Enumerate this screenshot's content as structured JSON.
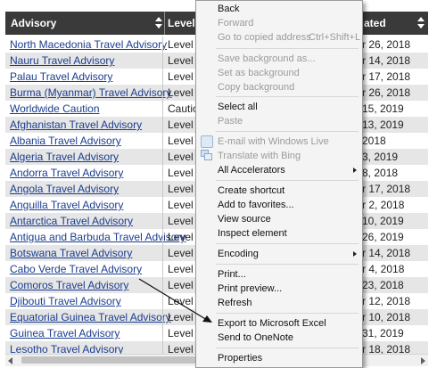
{
  "table": {
    "headers": {
      "advisory": "Advisory",
      "level": "Level",
      "updated": "ated"
    },
    "rows": [
      {
        "advisory": "North Macedonia Travel Advisory",
        "level": "Level 1",
        "updated": "r 26, 2018"
      },
      {
        "advisory": "Nauru Travel Advisory",
        "level": "Level 1",
        "updated": "r 14, 2018"
      },
      {
        "advisory": "Palau Travel Advisory",
        "level": "Level 1",
        "updated": "r 17, 2018"
      },
      {
        "advisory": "Burma (Myanmar) Travel Advisory",
        "level": "Level 2",
        "updated": "r 26, 2018"
      },
      {
        "advisory": "Worldwide Caution",
        "level": "Caution",
        "updated": "15, 2019"
      },
      {
        "advisory": "Afghanistan Travel Advisory",
        "level": "Level 4",
        "updated": "13, 2019"
      },
      {
        "advisory": "Albania Travel Advisory",
        "level": "Level 1",
        "updated": "2018"
      },
      {
        "advisory": "Algeria Travel Advisory",
        "level": "Level 2",
        "updated": "3, 2019"
      },
      {
        "advisory": "Andorra Travel Advisory",
        "level": "Level 1",
        "updated": "8, 2018"
      },
      {
        "advisory": "Angola Travel Advisory",
        "level": "Level 1",
        "updated": "r 17, 2018"
      },
      {
        "advisory": "Anguilla Travel Advisory",
        "level": "Level 1",
        "updated": "r 2, 2018"
      },
      {
        "advisory": "Antarctica Travel Advisory",
        "level": "Level 2",
        "updated": "10, 2019"
      },
      {
        "advisory": "Antigua and Barbuda Travel Advisory",
        "level": "Level 1",
        "updated": "26, 2019"
      },
      {
        "advisory": "Botswana Travel Advisory",
        "level": "Level 1",
        "updated": "r 14, 2018"
      },
      {
        "advisory": "Cabo Verde Travel Advisory",
        "level": "Level 1",
        "updated": "r 4, 2018"
      },
      {
        "advisory": "Comoros Travel Advisory",
        "level": "Level 2",
        "updated": "23, 2018"
      },
      {
        "advisory": "Djibouti Travel Advisory",
        "level": "Level 1",
        "updated": "r 12, 2018"
      },
      {
        "advisory": "Equatorial Guinea Travel Advisory",
        "level": "Level 1",
        "updated": "r 10, 2018"
      },
      {
        "advisory": "Guinea Travel Advisory",
        "level": "Level 1",
        "updated": "31, 2019"
      },
      {
        "advisory": "Lesotho Travel Advisory",
        "level": "Level 1",
        "updated": "r 18, 2018"
      }
    ]
  },
  "context_menu": {
    "back": "Back",
    "forward": "Forward",
    "go_to_copied_address": "Go to copied address",
    "go_to_copied_address_shortcut": "Ctrl+Shift+L",
    "save_background_as": "Save background as...",
    "set_as_background": "Set as background",
    "copy_background": "Copy background",
    "select_all": "Select all",
    "paste": "Paste",
    "email_with_windows_live": "E-mail with Windows Live",
    "translate_with_bing": "Translate with Bing",
    "all_accelerators": "All Accelerators",
    "create_shortcut": "Create shortcut",
    "add_to_favorites": "Add to favorites...",
    "view_source": "View source",
    "inspect_element": "Inspect element",
    "encoding": "Encoding",
    "print": "Print...",
    "print_preview": "Print preview...",
    "refresh": "Refresh",
    "export_to_microsoft_excel": "Export to Microsoft Excel",
    "send_to_onenote": "Send to OneNote",
    "properties": "Properties"
  },
  "colors": {
    "header_bg": "#3a3a3a",
    "link": "#1a3d8f",
    "alt_row": "#e6e6e6",
    "menu_bg": "#f4f4f4",
    "disabled_text": "#9b9b9b"
  },
  "icons": {
    "email_icon": "windows-live-mail-icon",
    "translate_icon": "bing-translate-icon",
    "annotation": "arrow-pointing-to-export-to-excel"
  }
}
